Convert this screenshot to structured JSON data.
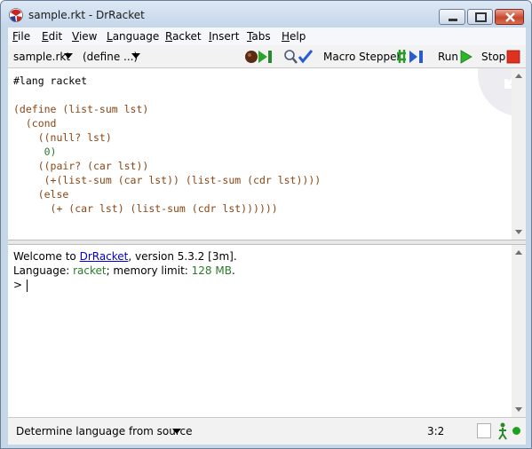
{
  "window": {
    "title": "sample.rkt - DrRacket",
    "accent_color": "#c7d7ea"
  },
  "menu": [
    "File",
    "Edit",
    "View",
    "Language",
    "Racket",
    "Insert",
    "Tabs",
    "Help"
  ],
  "toolbar": {
    "file_dropdown": "sample.rkt",
    "define_dropdown": "(define ...)",
    "macro_stepper_label": "Macro Stepper",
    "run_label": "Run",
    "stop_label": "Stop"
  },
  "definitions": {
    "lang_line": "#lang racket",
    "code_lines": [
      "(define (list-sum lst)",
      "  (cond",
      "    ((null? lst)",
      "     0)",
      "    ((pair? (car lst))",
      "     (+(list-sum (car lst)) (list-sum (cdr lst))))",
      "    (else",
      "      (+ (car lst) (list-sum (cdr lst))))))"
    ]
  },
  "interactions": {
    "welcome_prefix": "Welcome to ",
    "drracket_link": "DrRacket",
    "version_text": ", version 5.3.2 [3m].",
    "language_prefix": "Language: ",
    "language_name": "racket",
    "memory_prefix": "; memory limit: ",
    "memory_value": "128 MB",
    "memory_suffix": ".",
    "prompt": ">"
  },
  "status": {
    "language_selector": "Determine language from source",
    "cursor_position": "3:2",
    "running_color": "#1fa01f"
  }
}
